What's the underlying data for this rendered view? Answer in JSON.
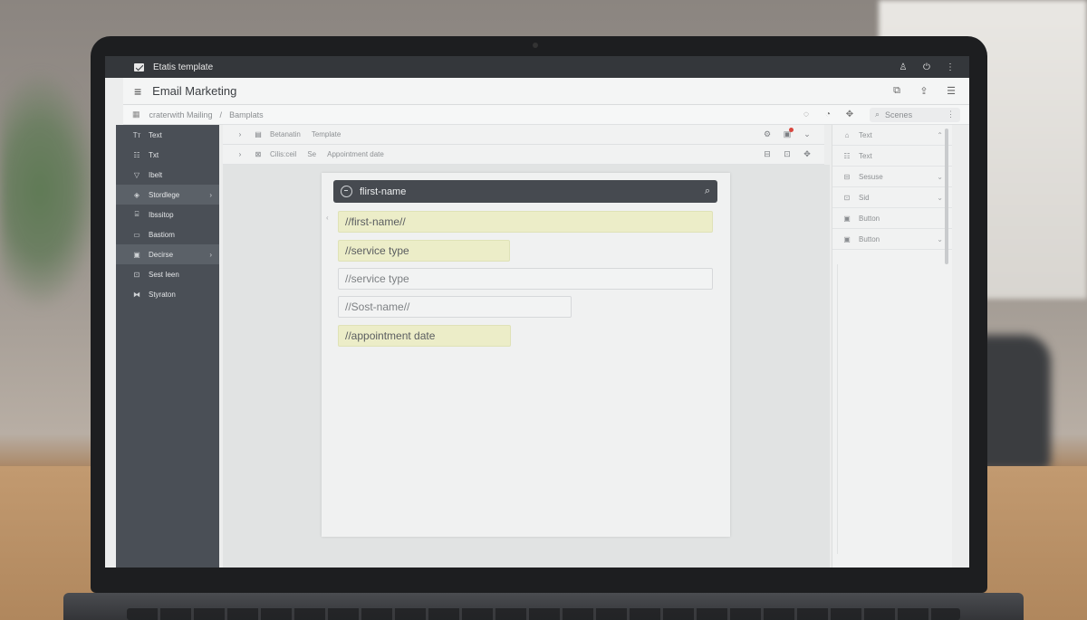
{
  "window": {
    "title": "Etatis template"
  },
  "app": {
    "title": "Email Marketing"
  },
  "breadcrumb": {
    "items": [
      "craterwith Mailing",
      "Bamplats"
    ],
    "separator": "/",
    "search_label": "Scenes"
  },
  "sidebar": {
    "items": [
      {
        "icon": "text-icon",
        "label": "Text"
      },
      {
        "icon": "list-icon",
        "label": "Txt"
      },
      {
        "icon": "filter-icon",
        "label": "Ibelt"
      },
      {
        "icon": "shape-icon",
        "label": "Stordlege"
      },
      {
        "icon": "layout-icon",
        "label": "Ibssitop"
      },
      {
        "icon": "button-icon",
        "label": "Bastiom"
      },
      {
        "icon": "section-icon",
        "label": "Decirse"
      },
      {
        "icon": "slot-icon",
        "label": "Sest Ieen"
      },
      {
        "icon": "sync-icon",
        "label": "Styraton"
      }
    ]
  },
  "subtoolbar": {
    "row1": {
      "labels": [
        "Betanatin",
        "Template"
      ]
    },
    "row2": {
      "labels": [
        "Cilis:ceil",
        "Se",
        "Appointment date"
      ]
    }
  },
  "document": {
    "header": "flirst-name",
    "fields": [
      {
        "text": "//first-name//"
      },
      {
        "text": "//service type"
      },
      {
        "text": "//service type"
      },
      {
        "text": "//Sost-name//"
      },
      {
        "text": "//appointment date"
      }
    ]
  },
  "right_panel": {
    "items": [
      {
        "label": "Text"
      },
      {
        "label": "Text"
      },
      {
        "label": "Sesuse"
      },
      {
        "label": "Sid"
      },
      {
        "label": "Button"
      },
      {
        "label": "Button"
      }
    ]
  },
  "colors": {
    "sidebar_bg": "#4a4f56",
    "doc_header_bg": "#464a50",
    "field_highlight": "#ecedc8",
    "notification_dot": "#d9463e"
  }
}
